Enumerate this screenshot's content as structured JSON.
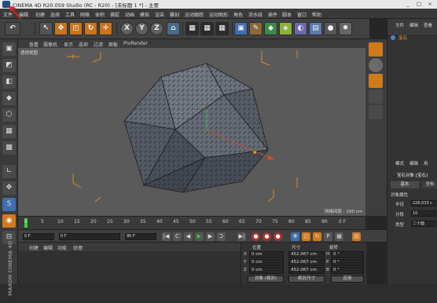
{
  "title_bar": {
    "title": "CINEMA 4D R20.059 Studio (RC - R20) - [未标题 1 *] - 主要",
    "min": "_",
    "max": "□",
    "close": "×"
  },
  "menu": [
    "文件",
    "编辑",
    "创建",
    "选择",
    "工具",
    "网格",
    "体积",
    "捕捉",
    "动画",
    "模拟",
    "渲染",
    "雕刻",
    "运动跟踪",
    "运动图形",
    "角色",
    "流水线",
    "插件",
    "脚本",
    "窗口",
    "帮助"
  ],
  "toolbar": {
    "undo": "↶",
    "x": "X",
    "y": "Y",
    "z": "Z"
  },
  "viewport": {
    "menu": [
      "查看",
      "摄像机",
      "显示",
      "选项",
      "过滤",
      "面板",
      "ProRender"
    ],
    "label": "透视视图",
    "grid_label": "网格间距 : 100 cm"
  },
  "object_manager": {
    "menu": [
      "文件",
      "编辑",
      "查看"
    ],
    "object_name": "宝石"
  },
  "attributes": {
    "menu": [
      "模式",
      "编辑",
      "用"
    ],
    "title": "宝石对象 [宝石]",
    "tab_basic": "基本",
    "tab_coord": "坐标",
    "section": "对象属性",
    "radius_label": "半径",
    "radius_value": "226.033 c",
    "segments_label": "分段",
    "segments_value": "10",
    "type_label": "类型",
    "type_value": "二十面"
  },
  "timeline": {
    "ticks": [
      "0",
      "5",
      "10",
      "15",
      "20",
      "25",
      "30",
      "35",
      "40",
      "45",
      "50",
      "55",
      "60",
      "65",
      "70",
      "75",
      "80",
      "85",
      "90"
    ],
    "end_frame": "0 F"
  },
  "time_controls": {
    "current": "0 F",
    "start": "0 F",
    "end": "90 F",
    "max": "90 F"
  },
  "material_manager": {
    "menu": [
      "创建",
      "编辑",
      "功能",
      "纹理"
    ]
  },
  "coords": {
    "headers": [
      "位置",
      "尺寸",
      "旋转"
    ],
    "rows": [
      {
        "axis": "X",
        "pos": "0 cm",
        "size": "452.067 cm",
        "rot_label": "H",
        "rot": "0 °"
      },
      {
        "axis": "Y",
        "pos": "0 cm",
        "size": "452.067 cm",
        "rot_label": "P",
        "rot": "0 °"
      },
      {
        "axis": "Z",
        "pos": "0 cm",
        "size": "452.067 cm",
        "rot_label": "B",
        "rot": "0 °"
      }
    ],
    "mode": "对象 (相对)",
    "size_mode": "绝对尺寸",
    "apply": "应用"
  },
  "branding": "MAXON CINEMA 4D",
  "colors": {
    "accent_orange": "#d07a1c",
    "bg": "#262626",
    "viewport": "#5a5a5a"
  }
}
